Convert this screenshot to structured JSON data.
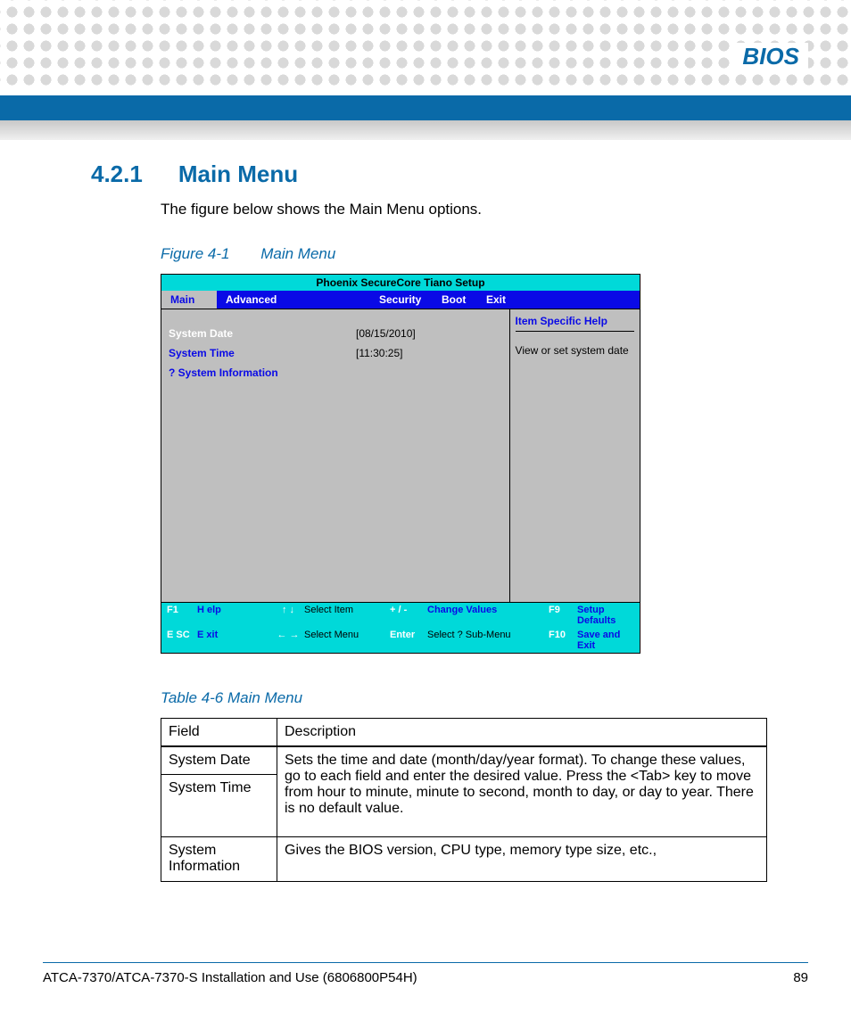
{
  "header": {
    "title": "BIOS"
  },
  "section": {
    "number": "4.2.1",
    "title": "Main Menu"
  },
  "intro": "The figure below shows the Main Menu options.",
  "figure_caption": {
    "num": "Figure 4-1",
    "title": "Main Menu"
  },
  "bios": {
    "setup_title": "Phoenix SecureCore Tiano Setup",
    "tabs": {
      "t1": "Main",
      "t2": "Advanced",
      "t3": "Security",
      "t4": "Boot",
      "t5": "Exit"
    },
    "rows": {
      "date_label": "System Date",
      "date_val": "[08/15/2010]",
      "time_label": "System Time",
      "time_val": "[11:30:25]",
      "info_label": "?  System Information"
    },
    "help": {
      "header": "Item Specific Help",
      "desc": "View or set system date"
    },
    "footer": {
      "r1": {
        "k1": "F1",
        "l1": "H elp",
        "k2": "↑ ↓",
        "l2": "Select Item",
        "k3": "+ / -",
        "l3": "Change Values",
        "k4": "F9",
        "l4": "Setup Defaults"
      },
      "r2": {
        "k1": "E SC",
        "l1": "E xit",
        "k2": "← →",
        "l2": "Select Menu",
        "k3": "Enter",
        "l3": "Select ?  Sub-Menu",
        "k4": "F10",
        "l4": "Save and Exit"
      }
    }
  },
  "table_caption": "Table 4-6 Main Menu",
  "table": {
    "headers": {
      "field": "Field",
      "desc": "Description"
    },
    "rows": {
      "r1_field": "System Date",
      "r2_field": "System Time",
      "r12_desc": "Sets the time and date (month/day/year format). To change these values, go to each field and enter the desired value. Press the <Tab> key to move from hour to minute, minute to second, month to day, or day to year. There is no default value.",
      "r3_field": "System Information",
      "r3_desc": "Gives the BIOS version, CPU type, memory type size, etc.,"
    }
  },
  "footer": {
    "doc": "ATCA-7370/ATCA-7370-S Installation and Use (6806800P54H)",
    "page": "89"
  }
}
